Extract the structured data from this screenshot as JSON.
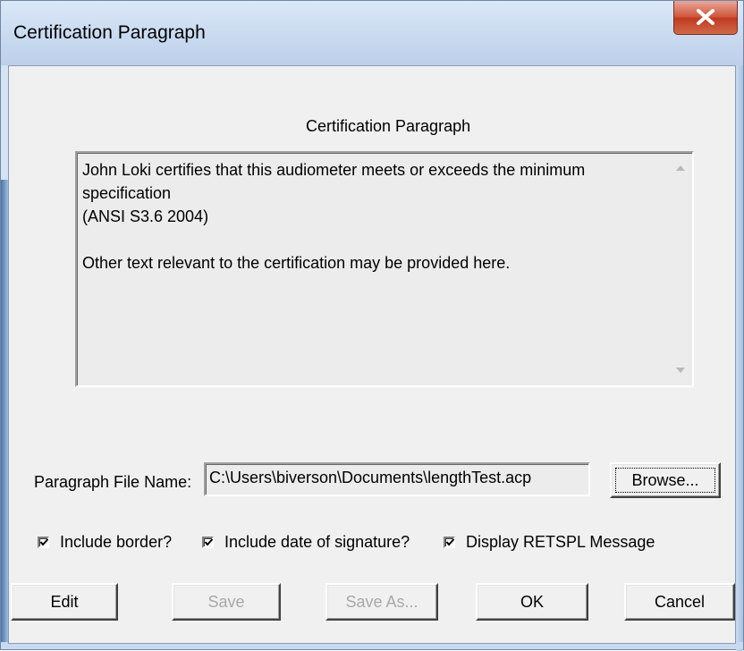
{
  "window": {
    "title": "Certification Paragraph"
  },
  "dialog": {
    "heading": "Certification Paragraph",
    "paragraph_text": "John Loki certifies that this audiometer meets or exceeds the minimum specification\n(ANSI S3.6 2004)\n\nOther text relevant to the certification may be provided here.",
    "file_name_label": "Paragraph File Name:",
    "file_name_value": "C:\\Users\\biverson\\Documents\\lengthTest.acp",
    "browse_label": "Browse...",
    "checkboxes": [
      {
        "label": "Include border?",
        "checked": true
      },
      {
        "label": "Include date of signature?",
        "checked": true
      },
      {
        "label": "Display RETSPL Message",
        "checked": true
      }
    ],
    "buttons": {
      "edit": "Edit",
      "save": "Save",
      "save_as": "Save As...",
      "ok": "OK",
      "cancel": "Cancel"
    }
  },
  "colors": {
    "close_button": "#c0391f",
    "dialog_bg": "#f0f0f0",
    "titlebar": "#c9daf0"
  }
}
